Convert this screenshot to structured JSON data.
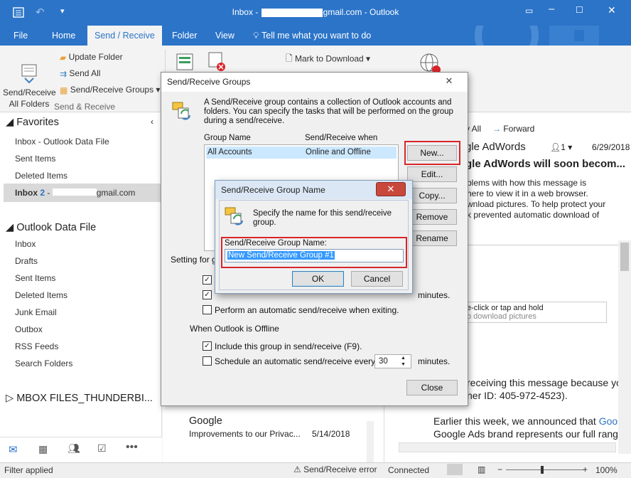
{
  "window": {
    "title_prefix": "Inbox - ",
    "title_suffix": "gmail.com - Outlook"
  },
  "menu": {
    "tabs": [
      "File",
      "Home",
      "Send / Receive",
      "Folder",
      "View"
    ],
    "tell_me": "Tell me what you want to do"
  },
  "ribbon": {
    "send_receive_all": "Send/Receive\nAll Folders",
    "update_folder": "Update Folder",
    "send_all": "Send All",
    "send_receive_groups": "Send/Receive Groups",
    "group_label": "Send & Receive",
    "mark_to_download": "Mark to Download"
  },
  "leftpane": {
    "favorites": "Favorites",
    "fav_items": [
      "Inbox - Outlook Data File",
      "Sent Items",
      "Deleted Items"
    ],
    "inbox_label": "Inbox",
    "inbox_count": "2",
    "inbox_suffix": "gmail.com",
    "data_file": "Outlook Data File",
    "data_items": [
      "Inbox",
      "Drafts",
      "Sent Items",
      "Deleted Items",
      "Junk Email",
      "Outbox",
      "RSS Feeds",
      "Search Folders"
    ],
    "mbox": "MBOX FILES_THUNDERBI..."
  },
  "midlist": {
    "sender": "Google",
    "subject": "Improvements to our Privac...",
    "date": "5/14/2018"
  },
  "reading": {
    "reply_all": "y All",
    "forward": "Forward",
    "from": "gle AdWords",
    "people": "1",
    "date": "6/29/2018",
    "subject": "gle AdWords will soon becom...",
    "info_lines": [
      "blems with how this message is",
      "here to view it in a web browser.",
      "wnload pictures. To help protect your",
      "k prevented automatic download of"
    ],
    "img_note_1": "e-click or tap and hold",
    "img_note_2": "o download pictures",
    "body_1": "receiving this message because yo",
    "body_2": "ner ID: 405-972-4523).",
    "body_3a": "Earlier this week, we announced that ",
    "body_3b": "Goo",
    "body_4": "Google Ads brand represents our full rang"
  },
  "status": {
    "filter": "Filter applied",
    "error": "Send/Receive error",
    "connected": "Connected",
    "zoom": "100%"
  },
  "groups_dialog": {
    "title": "Send/Receive Groups",
    "description": "A Send/Receive group contains a collection of Outlook accounts and folders. You can specify the tasks that will be performed on the group during a send/receive.",
    "col_name": "Group Name",
    "col_when": "Send/Receive when",
    "row_name": "All Accounts",
    "row_when": "Online and Offline",
    "btn_new": "New...",
    "btn_edit": "Edit...",
    "btn_copy": "Copy...",
    "btn_remove": "Remove",
    "btn_rename": "Rename",
    "setting_for": "Setting for g",
    "minutes_1": "minutes.",
    "exit_label": "Perform an automatic send/receive when exiting.",
    "offline_header": "When Outlook is Offline",
    "include_label": "Include this group in send/receive (F9).",
    "schedule_label": "Schedule an automatic send/receive every",
    "schedule_value": "30",
    "minutes_2": "minutes.",
    "btn_close": "Close"
  },
  "name_dialog": {
    "title": "Send/Receive Group Name",
    "prompt": "Specify the name for this send/receive group.",
    "field_label": "Send/Receive Group Name:",
    "field_value": "New Send/Receive Group #1",
    "btn_ok": "OK",
    "btn_cancel": "Cancel"
  },
  "colors": {
    "accent": "#2b74c8",
    "highlight": "#d9252b",
    "selection": "#cce8ff"
  }
}
